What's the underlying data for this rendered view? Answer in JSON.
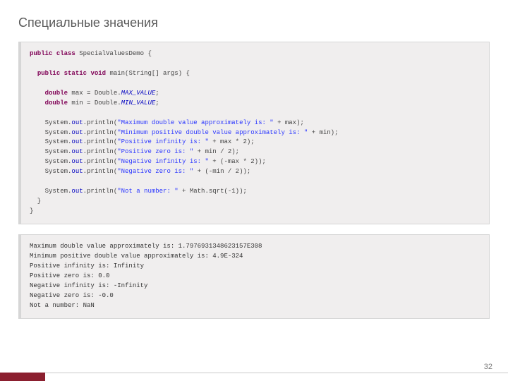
{
  "title": "Специальные значения",
  "page_number": "32",
  "code": {
    "l1a": "public",
    "l1b": "class",
    "l1c": " SpecialValuesDemo {",
    "l2a": "public",
    "l2b": "static",
    "l2c": "void",
    "l2d": " main(String[] args) {",
    "l3a": "double",
    "l3b": " max = Double.",
    "l3c": "MAX_VALUE",
    "l3d": ";",
    "l4a": "double",
    "l4b": " min = Double.",
    "l4c": "MIN_VALUE",
    "l4d": ";",
    "l5a": "System.",
    "l5b": "out",
    "l5c": ".println(",
    "l5d": "\"Maximum double value approximately is: \"",
    "l5e": " + max);",
    "l6a": "System.",
    "l6b": "out",
    "l6c": ".println(",
    "l6d": "\"Minimum positive double value approximately is: \"",
    "l6e": " + min);",
    "l7a": "System.",
    "l7b": "out",
    "l7c": ".println(",
    "l7d": "\"Positive infinity is: \"",
    "l7e": " + max * 2);",
    "l8a": "System.",
    "l8b": "out",
    "l8c": ".println(",
    "l8d": "\"Positive zero is: \"",
    "l8e": " + min / 2);",
    "l9a": "System.",
    "l9b": "out",
    "l9c": ".println(",
    "l9d": "\"Negative infinity is: \"",
    "l9e": " + (-max * 2));",
    "l10a": "System.",
    "l10b": "out",
    "l10c": ".println(",
    "l10d": "\"Negative zero is: \"",
    "l10e": " + (-min / 2));",
    "l11a": "System.",
    "l11b": "out",
    "l11c": ".println(",
    "l11d": "\"Not a number: \"",
    "l11e": " + Math.sqrt(-1));",
    "l12": "  }",
    "l13": "}"
  },
  "output": "Maximum double value approximately is: 1.7976931348623157E308\nMinimum positive double value approximately is: 4.9E-324\nPositive infinity is: Infinity\nPositive zero is: 0.0\nNegative infinity is: -Infinity\nNegative zero is: -0.0\nNot a number: NaN"
}
